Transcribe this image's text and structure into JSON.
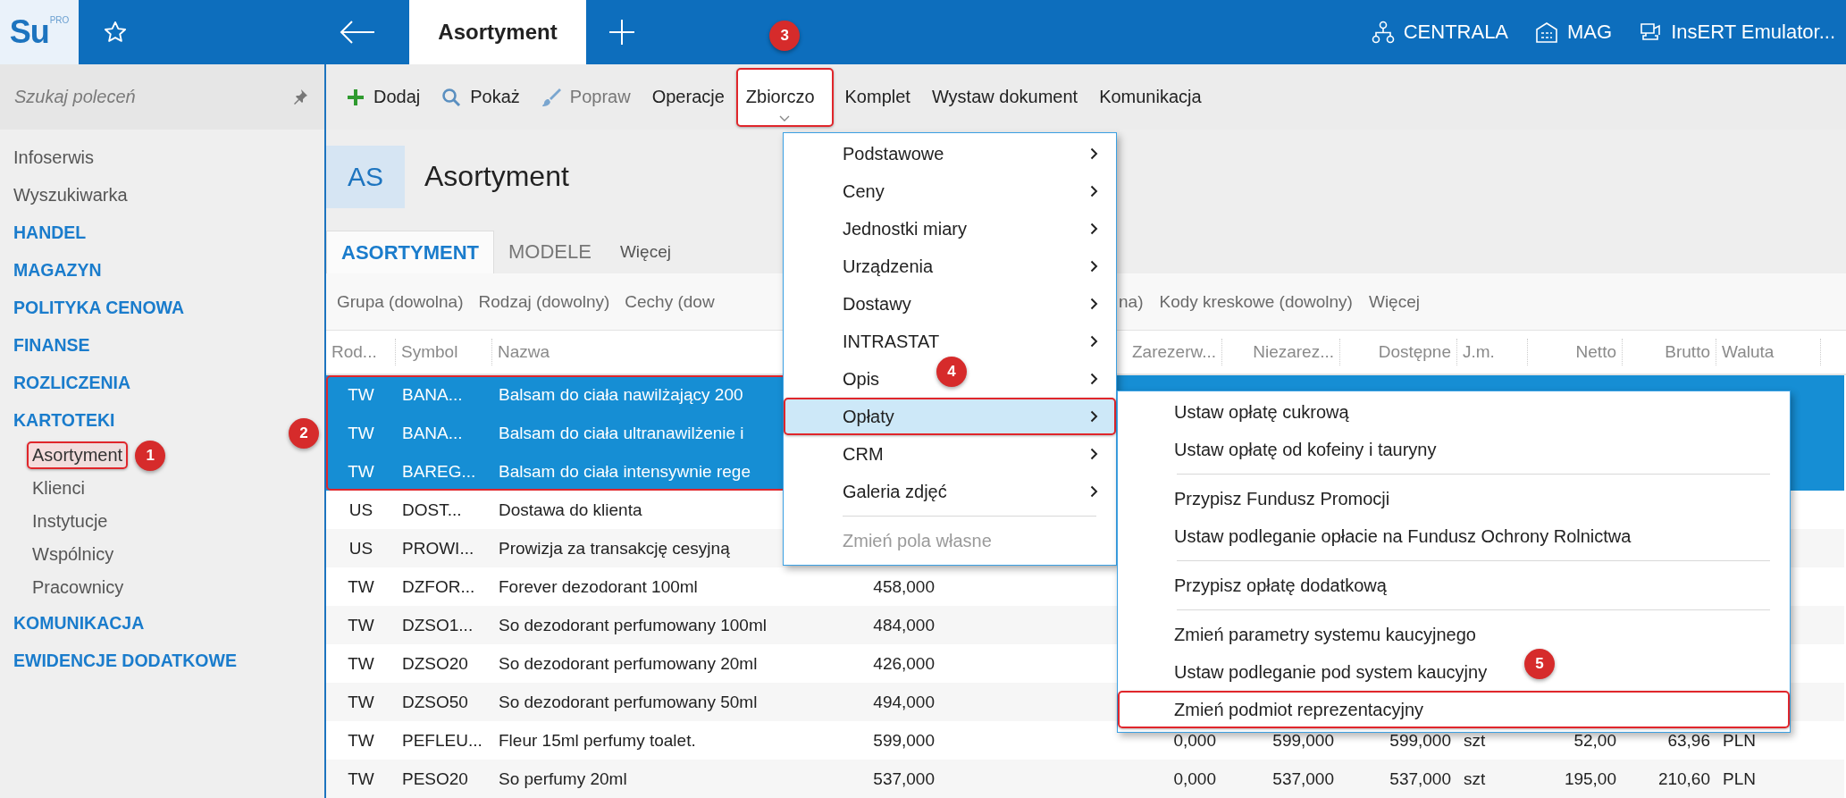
{
  "top_bar": {
    "logo": {
      "text": "Su",
      "superscript": "PRO"
    },
    "tab": {
      "label": "Asortyment",
      "selected": true
    },
    "contexts": [
      "CENTRALA",
      "MAG",
      "InsERT Emulator..."
    ]
  },
  "sidebar": {
    "search": {
      "placeholder": "Szukaj poleceń"
    },
    "items": [
      {
        "kind": "link",
        "label": "Infoserwis"
      },
      {
        "kind": "link",
        "label": "Wyszukiwarka"
      },
      {
        "kind": "section",
        "label": "HANDEL"
      },
      {
        "kind": "section",
        "label": "MAGAZYN"
      },
      {
        "kind": "section",
        "label": "POLITYKA CENOWA"
      },
      {
        "kind": "section",
        "label": "FINANSE"
      },
      {
        "kind": "section",
        "label": "ROZLICZENIA"
      },
      {
        "kind": "section",
        "label": "KARTOTEKI",
        "children": [
          {
            "label": "Asortyment",
            "selected": true,
            "annotation": "1"
          },
          {
            "label": "Klienci",
            "selected": false
          },
          {
            "label": "Instytucje",
            "selected": false
          },
          {
            "label": "Wspólnicy",
            "selected": false
          },
          {
            "label": "Pracownicy",
            "selected": false
          }
        ]
      },
      {
        "kind": "section",
        "label": "KOMUNIKACJA"
      },
      {
        "kind": "section",
        "label": "EWIDENCJE DODATKOWE"
      }
    ]
  },
  "toolbar": {
    "items": [
      {
        "label": "Dodaj",
        "disabled": false,
        "open": false
      },
      {
        "label": "Pokaż",
        "disabled": false,
        "open": false
      },
      {
        "label": "Popraw",
        "disabled": true,
        "open": false
      },
      {
        "label": "Operacje",
        "disabled": false,
        "open": false
      },
      {
        "label": "Zbiorczo",
        "disabled": false,
        "open": true,
        "annotation": "3"
      },
      {
        "label": "Komplet",
        "disabled": false,
        "open": false
      },
      {
        "label": "Wystaw dokument",
        "disabled": false,
        "open": false
      },
      {
        "label": "Komunikacja",
        "disabled": false,
        "open": false
      }
    ]
  },
  "page_header": {
    "badge": "AS",
    "title": "Asortyment"
  },
  "tabs": [
    {
      "kind": "tab",
      "label": "ASORTYMENT",
      "selected": true
    },
    {
      "kind": "tab",
      "label": "MODELE",
      "selected": false
    },
    {
      "kind": "more",
      "label": "Więcej",
      "selected": false
    }
  ],
  "filters": {
    "before_menu": [
      "Grupa (dowolna)",
      "Rodzaj (dowolny)",
      "Cechy (dow"
    ],
    "after_menu": [
      "na)",
      "Kody kreskowe (dowolny)",
      "Więcej"
    ]
  },
  "table": {
    "columns": {
      "rod": "Rod...",
      "symbol": "Symbol",
      "nazwa": "Nazwa",
      "zarezerw": "Zarezerw...",
      "niezarez": "Niezarez...",
      "dostepne": "Dostępne",
      "jm": "J.m.",
      "netto": "Netto",
      "brutto": "Brutto",
      "waluta": "Waluta"
    },
    "selection_annotation": "2",
    "rows": [
      {
        "selected": true,
        "rod": "TW",
        "symbol": "BANA...",
        "nazwa": "Balsam do ciała nawilżający 200"
      },
      {
        "selected": true,
        "rod": "TW",
        "symbol": "BANA...",
        "nazwa": "Balsam do ciała ultranawilżenie i"
      },
      {
        "selected": true,
        "rod": "TW",
        "symbol": "BAREG...",
        "nazwa": "Balsam do ciała intensywnie rege"
      },
      {
        "selected": false,
        "rod": "US",
        "symbol": "DOST...",
        "nazwa": "Dostawa do klienta"
      },
      {
        "selected": false,
        "rod": "US",
        "symbol": "PROWI...",
        "nazwa": "Prowizja za transakcję cesyjną"
      },
      {
        "selected": false,
        "rod": "TW",
        "symbol": "DZFOR...",
        "nazwa": "Forever dezodorant 100ml",
        "column_4": "458,000"
      },
      {
        "selected": false,
        "rod": "TW",
        "symbol": "DZSO1...",
        "nazwa": "So dezodorant perfumowany 100ml",
        "column_4": "484,000"
      },
      {
        "selected": false,
        "rod": "TW",
        "symbol": "DZSO20",
        "nazwa": "So dezodorant perfumowany 20ml",
        "column_4": "426,000"
      },
      {
        "selected": false,
        "rod": "TW",
        "symbol": "DZSO50",
        "nazwa": "So dezodorant perfumowany 50ml",
        "column_4": "494,000"
      },
      {
        "selected": false,
        "rod": "TW",
        "symbol": "PEFLEU...",
        "nazwa": "Fleur 15ml perfumy toalet.",
        "column_4": "599,000",
        "zarezerw": "0,000",
        "niezarez": "599,000",
        "dostepne": "599,000",
        "jm": "szt",
        "netto": "52,00",
        "brutto": "63,96",
        "waluta": "PLN"
      },
      {
        "selected": false,
        "rod": "TW",
        "symbol": "PESO20",
        "nazwa": "So perfumy 20ml",
        "column_4": "537,000",
        "zarezerw": "0,000",
        "niezarez": "537,000",
        "dostepne": "537,000",
        "jm": "szt",
        "netto": "195,00",
        "brutto": "210,60",
        "waluta": "PLN"
      }
    ]
  },
  "menu": {
    "items": [
      {
        "kind": "submenu",
        "label": "Podstawowe",
        "selected": false,
        "disabled": false
      },
      {
        "kind": "submenu",
        "label": "Ceny",
        "selected": false,
        "disabled": false
      },
      {
        "kind": "submenu",
        "label": "Jednostki miary",
        "selected": false,
        "disabled": false
      },
      {
        "kind": "submenu",
        "label": "Urządzenia",
        "selected": false,
        "disabled": false
      },
      {
        "kind": "submenu",
        "label": "Dostawy",
        "selected": false,
        "disabled": false
      },
      {
        "kind": "submenu",
        "label": "INTRASTAT",
        "selected": false,
        "disabled": false
      },
      {
        "kind": "submenu",
        "label": "Opis",
        "selected": false,
        "disabled": false
      },
      {
        "kind": "submenu",
        "label": "Opłaty",
        "selected": true,
        "disabled": false,
        "annotation": "4"
      },
      {
        "kind": "submenu",
        "label": "CRM",
        "selected": false,
        "disabled": false
      },
      {
        "kind": "submenu",
        "label": "Galeria zdjęć",
        "selected": false,
        "disabled": false
      },
      {
        "kind": "separator"
      },
      {
        "kind": "item",
        "label": "Zmień pola własne",
        "selected": false,
        "disabled": true
      }
    ]
  },
  "submenu": {
    "items": [
      {
        "kind": "item",
        "label": "Ustaw opłatę cukrową"
      },
      {
        "kind": "item",
        "label": "Ustaw opłatę od kofeiny i tauryny"
      },
      {
        "kind": "separator"
      },
      {
        "kind": "item",
        "label": "Przypisz Fundusz Promocji"
      },
      {
        "kind": "item",
        "label": "Ustaw podleganie opłacie na Fundusz Ochrony Rolnictwa"
      },
      {
        "kind": "separator"
      },
      {
        "kind": "item",
        "label": "Przypisz opłatę dodatkową"
      },
      {
        "kind": "separator"
      },
      {
        "kind": "item",
        "label": "Zmień parametry systemu kaucyjnego"
      },
      {
        "kind": "item",
        "label": "Ustaw podleganie pod system kaucyjny"
      },
      {
        "kind": "item",
        "label": "Zmień podmiot reprezentacyjny",
        "annotation": "5"
      }
    ]
  }
}
